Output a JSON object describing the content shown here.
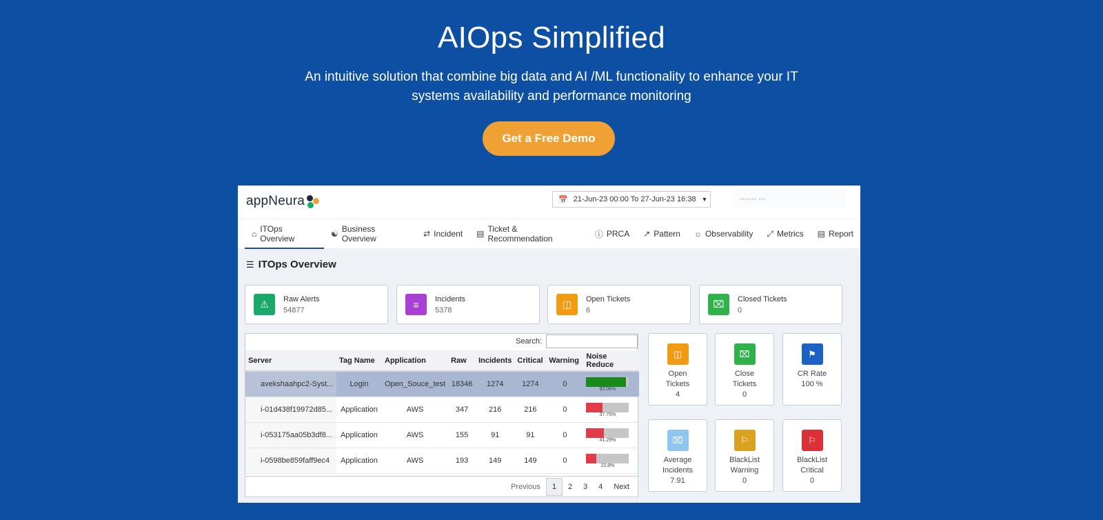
{
  "hero": {
    "title": "AIOps Simplified",
    "subtitle": "An intuitive solution that combine big data and AI /ML functionality to enhance your IT systems availability and performance monitoring",
    "cta": "Get a Free Demo"
  },
  "app": {
    "logo_text": "appNeura",
    "date_range": "21-Jun-23 00:00 To 27-Jun-23 16:38",
    "user_blurred": "••••••• •••",
    "nav": [
      "ITOps Overview",
      "Business Overview",
      "Incident",
      "Ticket & Recommendation",
      "PRCA",
      "Pattern",
      "Observability",
      "Metrics",
      "Report"
    ],
    "section_title": "ITOps Overview",
    "cards": [
      {
        "label": "Raw Alerts",
        "value": "54877",
        "color": "#1aa86b",
        "icon": "warning-icon"
      },
      {
        "label": "Incidents",
        "value": "5378",
        "color": "#a93fd3",
        "icon": "list-icon"
      },
      {
        "label": "Open Tickets",
        "value": "6",
        "color": "#f29b12",
        "icon": "ticket-icon"
      },
      {
        "label": "Closed Tickets",
        "value": "0",
        "color": "#2fb24a",
        "icon": "close-box-icon"
      }
    ],
    "table": {
      "search_label": "Search:",
      "headers": [
        "Server",
        "Tag Name",
        "Application",
        "Raw",
        "Incidents",
        "Critical",
        "Warning",
        "Noise Reduce"
      ],
      "rows": [
        {
          "server": "avekshaahpc2-Syst...",
          "tag": "Login",
          "app": "Open_Souce_test",
          "raw": "18346",
          "incidents": "1274",
          "critical": "1274",
          "warning": "0",
          "noise": "93.06%",
          "noise_frac": 0.93,
          "noise_color": "#1a8a1a"
        },
        {
          "server": "i-01d438f19972d85...",
          "tag": "Application",
          "app": "AWS",
          "raw": "347",
          "incidents": "216",
          "critical": "216",
          "warning": "0",
          "noise": "37.75%",
          "noise_frac": 0.3775,
          "noise_color": "#e23b4a"
        },
        {
          "server": "i-053175aa05b3df8...",
          "tag": "Application",
          "app": "AWS",
          "raw": "155",
          "incidents": "91",
          "critical": "91",
          "warning": "0",
          "noise": "41.29%",
          "noise_frac": 0.4129,
          "noise_color": "#e23b4a"
        },
        {
          "server": "i-0598be859faff9ec4",
          "tag": "Application",
          "app": "AWS",
          "raw": "193",
          "incidents": "149",
          "critical": "149",
          "warning": "0",
          "noise": "22.8%",
          "noise_frac": 0.228,
          "noise_color": "#e23b4a"
        }
      ],
      "pager": {
        "prev": "Previous",
        "pages": [
          "1",
          "2",
          "3",
          "4"
        ],
        "current": "1",
        "next": "Next"
      }
    },
    "minis": [
      {
        "l1": "Open",
        "l2": "Tickets",
        "v": "4",
        "color": "#f29b12",
        "icon": "ticket-icon"
      },
      {
        "l1": "Close",
        "l2": "Tickets",
        "v": "0",
        "color": "#2fb24a",
        "icon": "close-box-icon"
      },
      {
        "l1": "CR Rate",
        "l2": "",
        "v": "100 %",
        "color": "#1c62c4",
        "icon": "bookmark-icon"
      },
      {
        "l1": "Average",
        "l2": "Incidents",
        "v": "7.91",
        "color": "#8fc6ee",
        "icon": "close-box-icon"
      },
      {
        "l1": "BlackList",
        "l2": "Warning",
        "v": "0",
        "color": "#d9a220",
        "icon": "flag-icon"
      },
      {
        "l1": "BlackList",
        "l2": "Critical",
        "v": "0",
        "color": "#dc3038",
        "icon": "flag-icon"
      }
    ]
  }
}
